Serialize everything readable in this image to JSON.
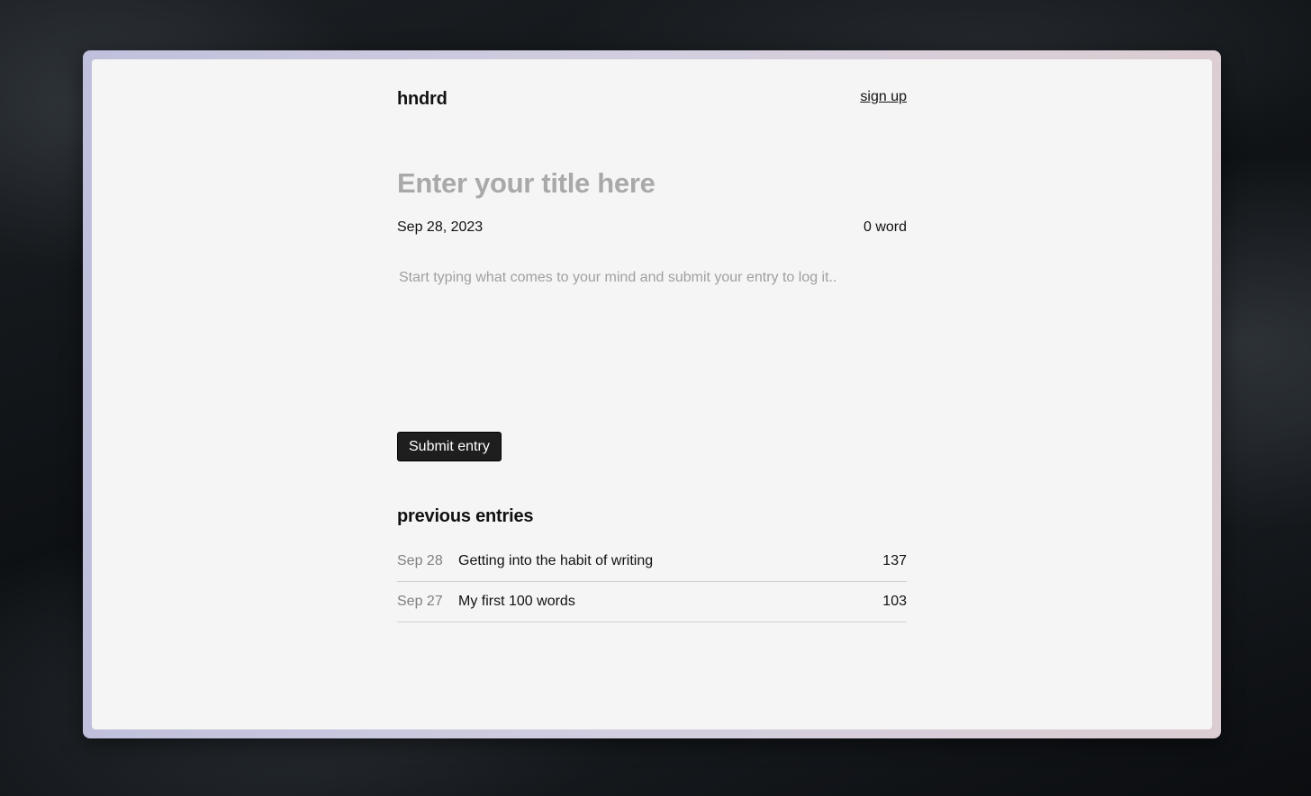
{
  "app": {
    "brand": "hndrd",
    "signup_label": "sign up"
  },
  "editor": {
    "title_placeholder": "Enter your title here",
    "date": "Sep 28, 2023",
    "word_count": "0 word",
    "body_placeholder": "Start typing what comes to your mind and submit your entry to log it..",
    "submit_label": "Submit entry"
  },
  "previous": {
    "heading": "previous entries",
    "entries": [
      {
        "date": "Sep 28",
        "title": "Getting into the habit of writing",
        "count": "137"
      },
      {
        "date": "Sep 27",
        "title": "My first 100 words",
        "count": "103"
      }
    ]
  }
}
